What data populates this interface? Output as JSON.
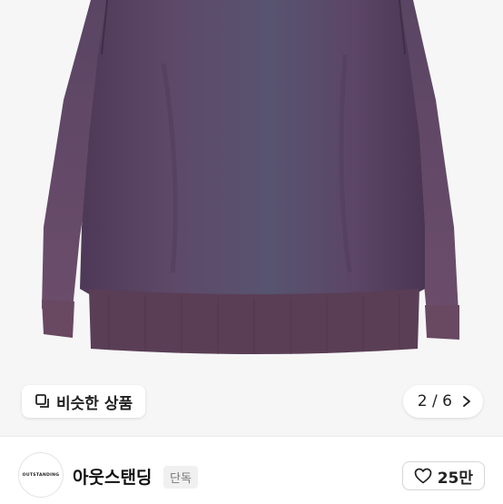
{
  "gallery": {
    "similar_label": "비슷한 상품",
    "similar_icon": "similar-items-icon",
    "current": "2",
    "separator": "/",
    "total": "6",
    "next_icon": "chevron-right-icon"
  },
  "store": {
    "logo_text": "OUTSTANDING",
    "name": "아웃스탠딩",
    "badge": "단독",
    "likes": "25만",
    "like_icon": "heart-outline-icon"
  },
  "colors": {
    "garment": "#564160",
    "garment_shadow": "#3e2e48",
    "background": "#f6f6f6"
  }
}
